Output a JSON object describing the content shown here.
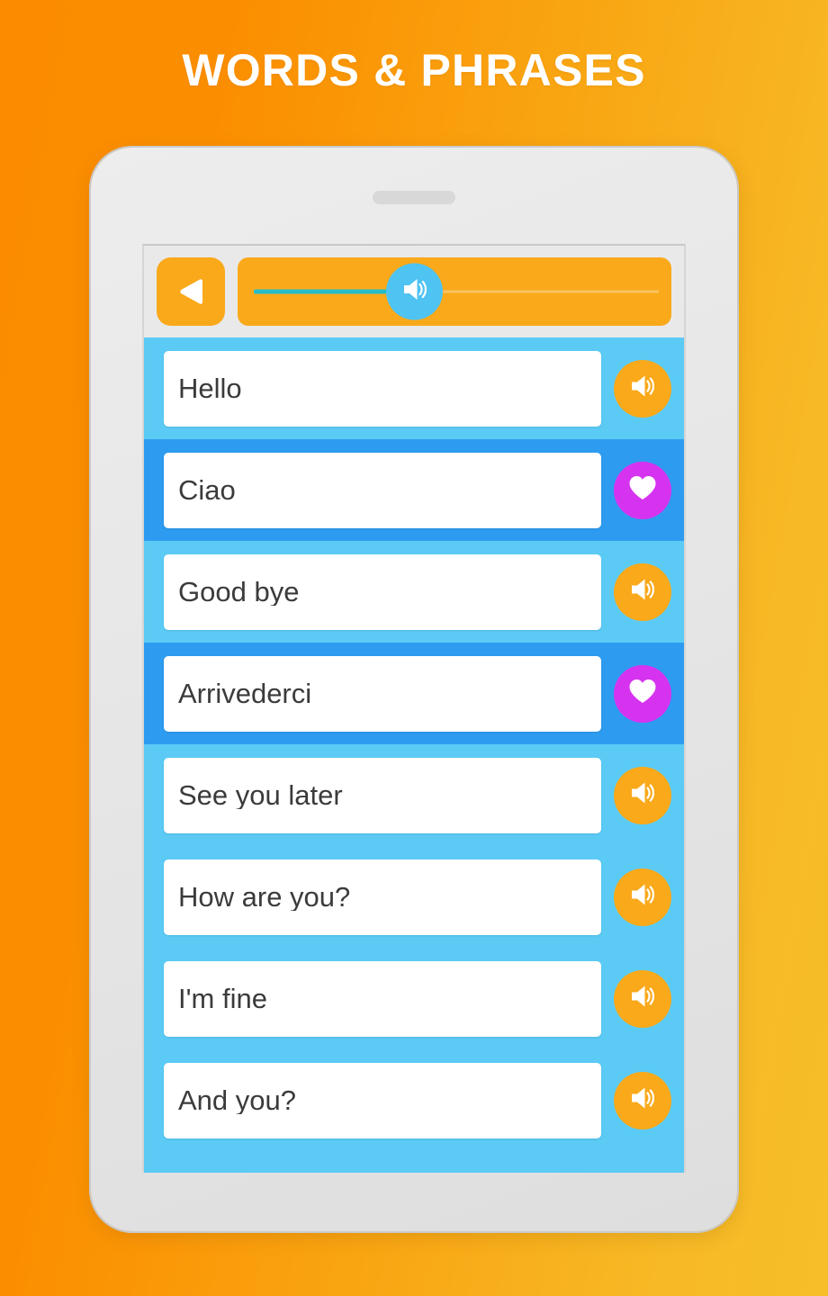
{
  "page": {
    "title": "WORDS & PHRASES",
    "background_from": "#FB8C00",
    "background_to": "#F6BE29"
  },
  "device": {
    "body_color": "#E7E7E7",
    "screen_background": "#ECECEC"
  },
  "toolbar": {
    "back_button_label": "back-arrow",
    "back_button_color": "#F9A91A",
    "seek_panel_color": "#F9A91A",
    "seek_fill_color": "#27BDC6",
    "seek_thumb_color": "#4FC3F2",
    "seek_thumb_icon": "speaker-icon",
    "seek_position_percent": 32
  },
  "list": {
    "tone_light": "#5BCBF5",
    "tone_dark": "#2D9CF0",
    "speaker_button_color": "#F9A91A",
    "favorite_button_color": "#D633F0",
    "rows": [
      {
        "text": "Hello",
        "tone": "light",
        "action": "speaker",
        "action_icon": "speaker-icon"
      },
      {
        "text": "Ciao",
        "tone": "dark",
        "action": "heart",
        "action_icon": "heart-icon"
      },
      {
        "text": "Good bye",
        "tone": "light",
        "action": "speaker",
        "action_icon": "speaker-icon"
      },
      {
        "text": "Arrivederci",
        "tone": "dark",
        "action": "heart",
        "action_icon": "heart-icon"
      },
      {
        "text": "See you later",
        "tone": "light",
        "action": "speaker",
        "action_icon": "speaker-icon"
      },
      {
        "text": "How are you?",
        "tone": "light",
        "action": "speaker",
        "action_icon": "speaker-icon"
      },
      {
        "text": "I'm fine",
        "tone": "light",
        "action": "speaker",
        "action_icon": "speaker-icon"
      },
      {
        "text": "And you?",
        "tone": "light",
        "action": "speaker",
        "action_icon": "speaker-icon"
      },
      {
        "text": "",
        "tone": "light",
        "action": "none",
        "action_icon": ""
      }
    ]
  }
}
